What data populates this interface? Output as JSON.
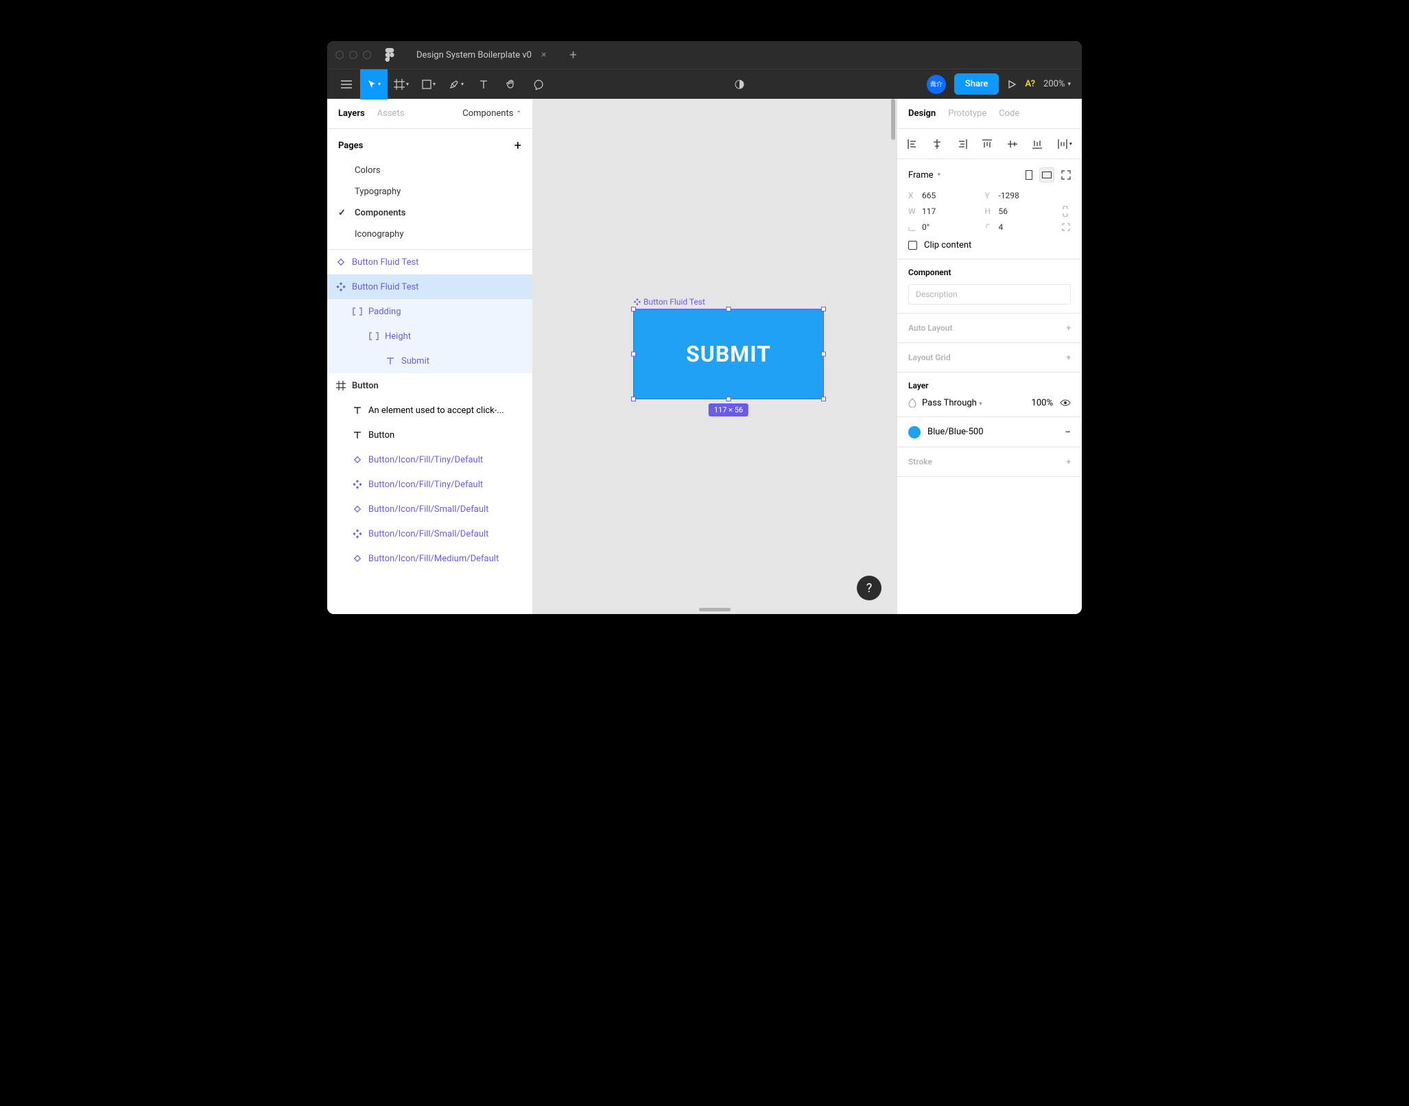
{
  "tab_title": "Design System Boilerplate v0",
  "toolbar": {
    "share": "Share",
    "a_indicator": "A?",
    "zoom": "200%",
    "avatar": "喬介"
  },
  "left": {
    "tabs": {
      "layers": "Layers",
      "assets": "Assets",
      "dropdown": "Components"
    },
    "pages_header": "Pages",
    "pages": [
      {
        "label": "Colors",
        "current": false
      },
      {
        "label": "Typography",
        "current": false
      },
      {
        "label": "Components",
        "current": true
      },
      {
        "label": "Iconography",
        "current": false
      }
    ],
    "layers": [
      {
        "label": "Button Fluid Test",
        "icon": "diamond",
        "indent": 0,
        "cls": "purple"
      },
      {
        "label": "Button Fluid Test",
        "icon": "fourdiamond",
        "indent": 0,
        "cls": "purple selected"
      },
      {
        "label": "Padding",
        "icon": "brackets",
        "indent": 1,
        "cls": "purple nested-bg"
      },
      {
        "label": "Height",
        "icon": "brackets",
        "indent": 2,
        "cls": "purple nested-bg"
      },
      {
        "label": "Submit",
        "icon": "text",
        "indent": 3,
        "cls": "purple nested-bg"
      },
      {
        "label": "Button",
        "icon": "hash",
        "indent": 0,
        "cls": "bold"
      },
      {
        "label": "An element used to accept click-...",
        "icon": "text",
        "indent": 1,
        "cls": ""
      },
      {
        "label": "Button",
        "icon": "text",
        "indent": 1,
        "cls": ""
      },
      {
        "label": "Button/Icon/Fill/Tiny/Default",
        "icon": "diamond",
        "indent": 1,
        "cls": "purple"
      },
      {
        "label": "Button/Icon/Fill/Tiny/Default",
        "icon": "fourdiamond",
        "indent": 1,
        "cls": "purple"
      },
      {
        "label": "Button/Icon/Fill/Small/Default",
        "icon": "diamond",
        "indent": 1,
        "cls": "purple"
      },
      {
        "label": "Button/Icon/Fill/Small/Default",
        "icon": "fourdiamond",
        "indent": 1,
        "cls": "purple"
      },
      {
        "label": "Button/Icon/Fill/Medium/Default",
        "icon": "diamond",
        "indent": 1,
        "cls": "purple"
      }
    ]
  },
  "canvas": {
    "frame_label": "Button Fluid Test",
    "button_text": "SUBMIT",
    "dimensions": "117 × 56"
  },
  "right": {
    "tabs": {
      "design": "Design",
      "prototype": "Prototype",
      "code": "Code"
    },
    "frame_label": "Frame",
    "x": "665",
    "y": "-1298",
    "w": "117",
    "h": "56",
    "rotation": "0°",
    "radius": "4",
    "clip": "Clip content",
    "component_title": "Component",
    "description_placeholder": "Description",
    "auto_layout": "Auto Layout",
    "layout_grid": "Layout Grid",
    "layer_title": "Layer",
    "blend_mode": "Pass Through",
    "opacity": "100%",
    "fill_name": "Blue/Blue-500",
    "stroke": "Stroke"
  }
}
